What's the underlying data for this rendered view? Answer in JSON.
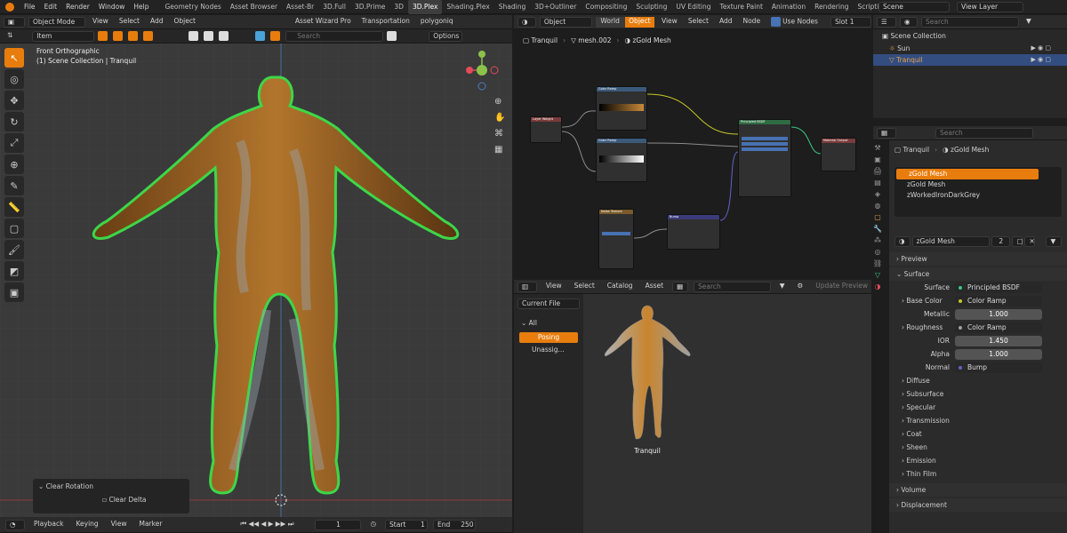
{
  "topbar": {
    "menus": [
      "File",
      "Edit",
      "Render",
      "Window",
      "Help"
    ],
    "workspaces": [
      "Geometry Nodes",
      "Asset Browser",
      "Asset-Br",
      "3D.Full",
      "3D.Prime",
      "3D",
      "3D.Plex",
      "Shading.Plex",
      "Shading",
      "3D+Outliner",
      "Compositing",
      "Sculpting",
      "UV Editing",
      "Texture Paint",
      "Animation",
      "Rendering",
      "Scripting"
    ],
    "active_workspace": "3D.Plex",
    "scene": "Scene",
    "view_layer": "View Layer"
  },
  "viewport": {
    "mode": "Object Mode",
    "menus": [
      "View",
      "Select",
      "Add",
      "Object"
    ],
    "addon1": "Asset Wizard Pro",
    "addon2": "Transportation",
    "addon3": "polygoniq",
    "item": "Item",
    "search_ph": "Search",
    "options": "Options",
    "title": "Front Orthographic",
    "subtitle": "(1) Scene Collection | Tranquil",
    "redo_title": "Clear Rotation",
    "redo_opt": "Clear Delta"
  },
  "timeline": {
    "playback": "Playback",
    "keying": "Keying",
    "view": "View",
    "marker": "Marker",
    "frame": "1",
    "start_label": "Start",
    "start": "1",
    "end_label": "End",
    "end": "250"
  },
  "node_editor": {
    "type": "Object",
    "world": "World",
    "object": "Object",
    "menus": [
      "View",
      "Select",
      "Add",
      "Node"
    ],
    "use_nodes": "Use Nodes",
    "slot": "Slot 1",
    "bc1": "Tranquil",
    "bc2": "mesh.002",
    "bc3": "zGold Mesh"
  },
  "nodes": {
    "n1": "Color Ramp",
    "n2": "Layer Weight",
    "n3": "Color Ramp",
    "n4": "Principled BSDF",
    "n5": "Material Output",
    "n6": "Noise Texture",
    "n7": "Bump"
  },
  "asset": {
    "menus": [
      "View",
      "Select",
      "Catalog",
      "Asset"
    ],
    "search_ph": "Search",
    "update": "Update Preview",
    "library": "Current File",
    "all": "All",
    "cat1": "Posing",
    "cat2": "Unassig...",
    "asset_name": "Tranquil"
  },
  "outliner": {
    "search_ph": "Search",
    "root": "Scene Collection",
    "items": [
      "Sun",
      "Tranquil"
    ]
  },
  "props": {
    "obj": "Tranquil",
    "mat": "zGold Mesh",
    "slots": [
      "zGold Mesh",
      "zGold Mesh",
      "zWorkedIronDarkGrey"
    ],
    "mat_field": "zGold Mesh",
    "users": "2",
    "search_ph": "Search",
    "preview": "Preview",
    "surface": "Surface",
    "surface_label": "Surface",
    "shader": "Principled BSDF",
    "rows": [
      {
        "label": "Base Color",
        "value": "Color Ramp"
      },
      {
        "label": "Metallic",
        "value": "1.000"
      },
      {
        "label": "Roughness",
        "value": "Color Ramp"
      },
      {
        "label": "IOR",
        "value": "1.450"
      },
      {
        "label": "Alpha",
        "value": "1.000"
      },
      {
        "label": "Normal",
        "value": "Bump"
      }
    ],
    "sections": [
      "Diffuse",
      "Subsurface",
      "Specular",
      "Transmission",
      "Coat",
      "Sheen",
      "Emission",
      "Thin Film"
    ],
    "volume": "Volume",
    "displacement": "Displacement"
  }
}
